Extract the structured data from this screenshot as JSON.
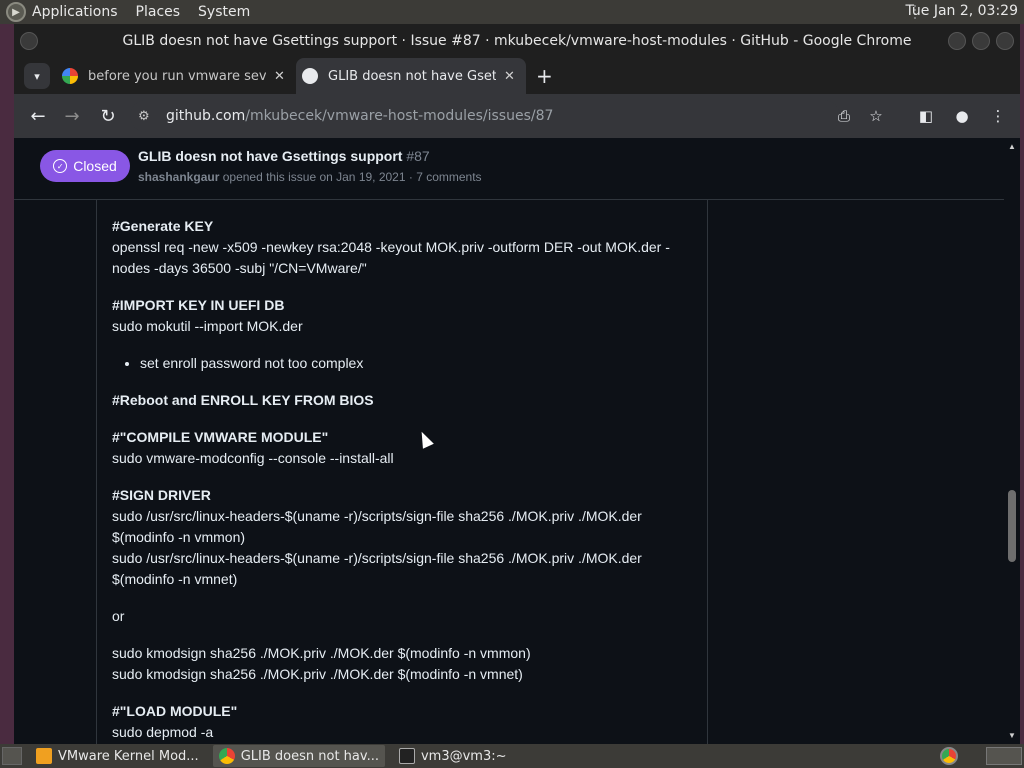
{
  "system_panel": {
    "menus": [
      "Applications",
      "Places",
      "System"
    ],
    "clock": "Tue Jan  2, 03:29"
  },
  "window": {
    "title": "GLIB doesn not have Gsettings support · Issue #87 · mkubecek/vmware-host-modules · GitHub - Google Chrome"
  },
  "tabs": [
    {
      "title": "before you run vmware sever",
      "icon": "google-icon"
    },
    {
      "title": "GLIB doesn not have Gsettings",
      "icon": "github-icon"
    }
  ],
  "toolbar": {
    "url_host": "github.com",
    "url_path": "/mkubecek/vmware-host-modules/issues/87"
  },
  "issue": {
    "state": "Closed",
    "title": "GLIB doesn not have Gsettings support",
    "number": "#87",
    "author": "shashankgaur",
    "meta": "opened this issue on Jan 19, 2021 · 7 comments"
  },
  "comment": {
    "generate_heading": "#Generate KEY",
    "generate_cmd": "openssl req -new -x509 -newkey rsa:2048 -keyout MOK.priv -outform DER -out MOK.der -nodes -days 36500 -subj \"/CN=VMware/\"",
    "import_heading": "#IMPORT KEY IN UEFI DB",
    "import_cmd": "sudo mokutil --import MOK.der",
    "import_bullet": "set enroll password not too complex",
    "reboot_heading": "#Reboot and ENROLL KEY FROM BIOS",
    "compile_heading": "#\"COMPILE VMWARE MODULE\"",
    "compile_cmd": "sudo vmware-modconfig --console --install-all",
    "sign_heading": "#SIGN DRIVER",
    "sign_cmd1": "sudo /usr/src/linux-headers-$(uname -r)/scripts/sign-file sha256 ./MOK.priv ./MOK.der $(modinfo -n vmmon)",
    "sign_cmd2": "sudo /usr/src/linux-headers-$(uname -r)/scripts/sign-file sha256 ./MOK.priv ./MOK.der $(modinfo -n vmnet)",
    "or": "or",
    "kmod_cmd1": "sudo kmodsign sha256 ./MOK.priv ./MOK.der $(modinfo -n vmmon)",
    "kmod_cmd2": "sudo kmodsign sha256 ./MOK.priv ./MOK.der $(modinfo -n vmnet)",
    "load_heading": "#\"LOAD MODULE\"",
    "load_cmd": "sudo depmod -a"
  },
  "taskbar": {
    "tasks": [
      {
        "label": "VMware Kernel Mod...",
        "icon": "vmware-icon"
      },
      {
        "label": "GLIB doesn not hav...",
        "icon": "chrome-icon"
      },
      {
        "label": "vm3@vm3:~",
        "icon": "terminal-icon"
      }
    ]
  },
  "colors": {
    "closed_badge": "#8957e5",
    "page_bg": "#0d1117",
    "desktop": "#4a2b40"
  }
}
